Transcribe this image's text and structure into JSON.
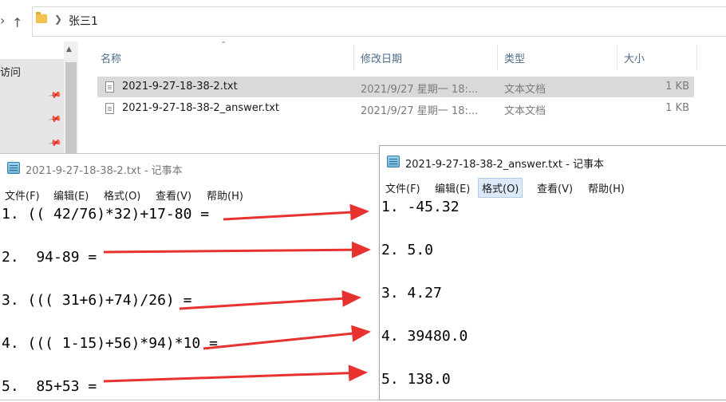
{
  "explorer": {
    "breadcrumb": "张三1",
    "nav_item": "访问",
    "columns": {
      "name": "名称",
      "date": "修改日期",
      "type": "类型",
      "size": "大小"
    },
    "files": [
      {
        "name": "2021-9-27-18-38-2.txt",
        "date": "2021/9/27 星期一 18:...",
        "type": "文本文档",
        "size": "1 KB",
        "selected": true
      },
      {
        "name": "2021-9-27-18-38-2_answer.txt",
        "date": "2021/9/27 星期一 18:...",
        "type": "文本文档",
        "size": "1 KB",
        "selected": false
      }
    ]
  },
  "notepad_left": {
    "title": "2021-9-27-18-38-2.txt - 记事本",
    "menu": [
      "文件(F)",
      "编辑(E)",
      "格式(O)",
      "查看(V)",
      "帮助(H)"
    ],
    "lines": [
      "1. (( 42/76)*32)+17-80 =",
      "2.  94-89 =",
      "3. ((( 31+6)+74)/26) =",
      "4. ((( 1-15)+56)*94)*10 =",
      "5.  85+53 ="
    ]
  },
  "notepad_right": {
    "title": "2021-9-27-18-38-2_answer.txt - 记事本",
    "menu": [
      "文件(F)",
      "编辑(E)",
      "格式(O)",
      "查看(V)",
      "帮助(H)"
    ],
    "active_menu": "格式(O)",
    "lines": [
      "1. -45.32",
      "2. 5.0",
      "3. 4.27",
      "4. 39480.0",
      "5. 138.0"
    ]
  },
  "annotation": {
    "arrow_color": "#e8322f"
  }
}
